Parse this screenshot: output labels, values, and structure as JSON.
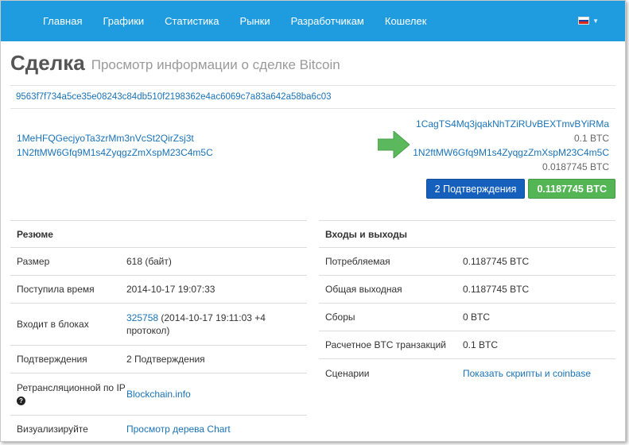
{
  "nav": {
    "items": [
      {
        "label": "Главная"
      },
      {
        "label": "Графики"
      },
      {
        "label": "Статистика"
      },
      {
        "label": "Рынки"
      },
      {
        "label": "Разработчикам"
      },
      {
        "label": "Кошелек"
      }
    ],
    "language_flag": "flag-russia-icon"
  },
  "header": {
    "title": "Сделка",
    "subtitle": "Просмотр информации о сделке Bitcoin"
  },
  "tx_hash": "9563f7f734a5ce35e08243c84db510f2198362e4ac6069c7a83a642a58ba6c03",
  "inputs": [
    {
      "address": "1MeHFQGecjyoTa3zrMm3nVcSt2QirZsj3t"
    },
    {
      "address": "1N2ftMW6Gfq9M1s4ZyqgzZmXspM23C4m5C"
    }
  ],
  "outputs": [
    {
      "address": "1CagTS4Mq3jqakNhTZiRUvBEXTmvBYiRMa",
      "amount": "0.1 BTC"
    },
    {
      "address": "1N2ftMW6Gfq9M1s4ZyqgzZmXspM23C4m5C",
      "amount": "0.0187745 BTC"
    }
  ],
  "badges": {
    "confirmations": "2 Подтверждения",
    "total": "0.1187745 BTC"
  },
  "summary": {
    "title": "Резюме",
    "rows": [
      {
        "label": "Размер",
        "value": "618 (байт)"
      },
      {
        "label": "Поступила время",
        "value": "2014-10-17 19:07:33"
      },
      {
        "label": "Входит в блоках",
        "link": "325758",
        "value": " (2014-10-17 19:11:03 +4 протокол)"
      },
      {
        "label": "Подтверждения",
        "value": "2 Подтверждения"
      },
      {
        "label": "Ретрансляционной по IP",
        "link": "Blockchain.info"
      },
      {
        "label": "Визуализируйте",
        "link": "Просмотр дерева Chart"
      }
    ]
  },
  "io": {
    "title": "Входы и выходы",
    "rows": [
      {
        "label": "Потребляемая",
        "value": "0.1187745 BTC"
      },
      {
        "label": "Общая выходная",
        "value": "0.1187745 BTC"
      },
      {
        "label": "Сборы",
        "value": "0 BTC"
      },
      {
        "label": "Расчетное BTC транзакций",
        "value": "0.1 BTC"
      },
      {
        "label": "Сценарии",
        "link": "Показать скрипты и coinbase"
      }
    ]
  },
  "colors": {
    "navbar": "#1f9ce0",
    "link": "#1a73b8",
    "confirm_badge": "#1560bd",
    "amount_badge": "#54b554",
    "arrow": "#5cb85c"
  }
}
